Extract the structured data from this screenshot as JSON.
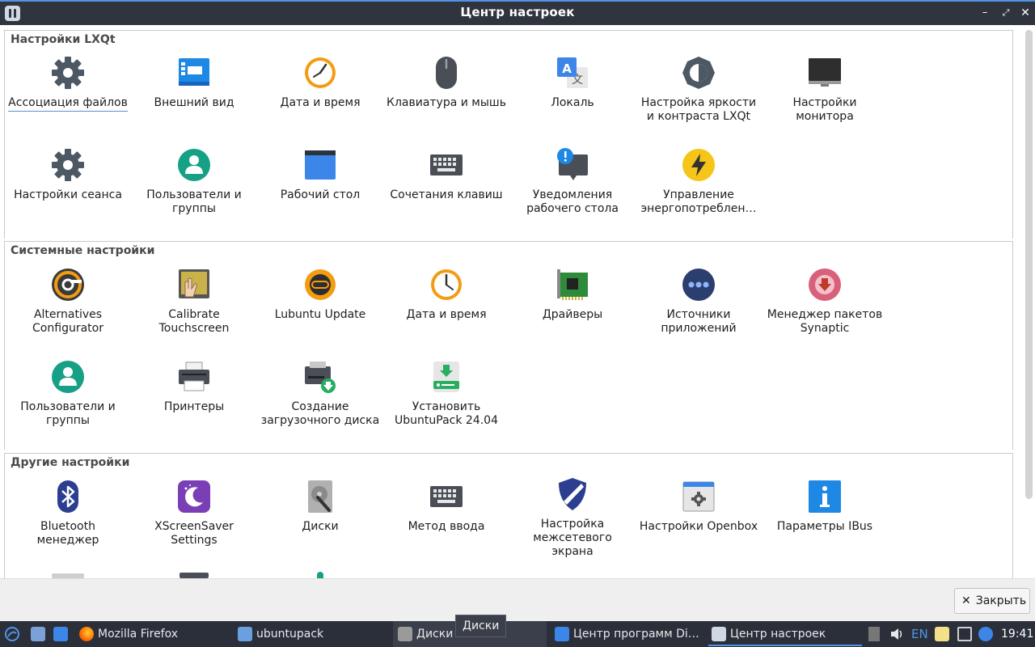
{
  "window": {
    "title": "Центр настроек",
    "minimize_glyph": "–",
    "maximize_glyph": "⤢",
    "close_glyph": "✕"
  },
  "sections": [
    {
      "title": "Настройки LXQt",
      "items": [
        {
          "label": "Ассоциация файлов",
          "icon": "gear-icon"
        },
        {
          "label": "Внешний вид",
          "icon": "appearance-icon"
        },
        {
          "label": "Дата и время",
          "icon": "clock-icon"
        },
        {
          "label": "Клавиатура и мышь",
          "icon": "mouse-icon"
        },
        {
          "label": "Локаль",
          "icon": "locale-icon"
        },
        {
          "label": "Настройка яркости и контраста LXQt",
          "icon": "brightness-icon"
        },
        {
          "label": "Настройки монитора",
          "icon": "monitor-icon"
        },
        {
          "label": "Настройки сеанса",
          "icon": "gear-icon"
        },
        {
          "label": "Пользователи и группы",
          "icon": "user-icon"
        },
        {
          "label": "Рабочий стол",
          "icon": "desktop-icon"
        },
        {
          "label": "Сочетания клавиш",
          "icon": "keyboard-icon"
        },
        {
          "label": "Уведомления рабочего стола",
          "icon": "notification-icon"
        },
        {
          "label": "Управление энергопотреблен…",
          "icon": "power-icon"
        }
      ]
    },
    {
      "title": "Системные настройки",
      "items": [
        {
          "label": "Alternatives Configurator",
          "icon": "alternatives-icon"
        },
        {
          "label": "Calibrate Touchscreen",
          "icon": "touchscreen-icon"
        },
        {
          "label": "Lubuntu Update",
          "icon": "update-icon"
        },
        {
          "label": "Дата и время",
          "icon": "clock-icon"
        },
        {
          "label": "Драйверы",
          "icon": "driver-card-icon"
        },
        {
          "label": "Источники приложений",
          "icon": "sources-icon"
        },
        {
          "label": "Менеджер пакетов Synaptic",
          "icon": "synaptic-icon"
        },
        {
          "label": "Пользователи и группы",
          "icon": "user-icon"
        },
        {
          "label": "Принтеры",
          "icon": "printer-icon"
        },
        {
          "label": "Создание загрузочного диска",
          "icon": "startup-disk-icon"
        },
        {
          "label": "Установить UbuntuPack 24.04",
          "icon": "install-icon"
        }
      ]
    },
    {
      "title": "Другие настройки",
      "items": [
        {
          "label": "Bluetooth менеджер",
          "icon": "bluetooth-icon"
        },
        {
          "label": "XScreenSaver Settings",
          "icon": "screensaver-icon"
        },
        {
          "label": "Диски",
          "icon": "disks-icon"
        },
        {
          "label": "Метод ввода",
          "icon": "keyboard-icon"
        },
        {
          "label": "Настройка межсетевого экрана",
          "icon": "firewall-icon"
        },
        {
          "label": "Настройки Openbox",
          "icon": "openbox-icon"
        },
        {
          "label": "Параметры IBus",
          "icon": "info-icon"
        }
      ]
    }
  ],
  "bottom": {
    "close_label": "Закрыть",
    "close_glyph": "✕"
  },
  "taskbar": {
    "firefox": "Mozilla Firefox",
    "folder": "ubuntupack",
    "disks": "Диски",
    "software_center": "Центр программ Di…",
    "settings_center": "Центр настроек",
    "tooltip": "Диски",
    "keyboard_layout": "EN",
    "clock": "19:41"
  },
  "colors": {
    "accent": "#5294e2",
    "titlebar": "#2f343f",
    "taskbar": "#2b2f3a"
  }
}
